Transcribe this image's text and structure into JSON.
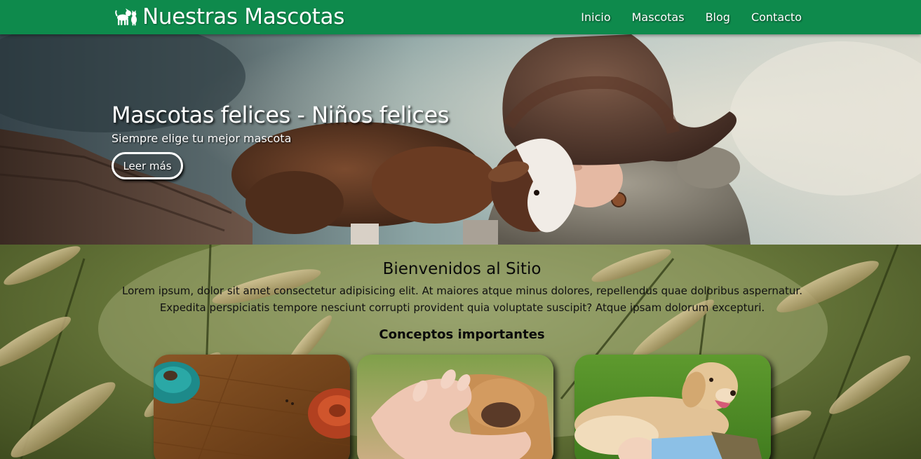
{
  "header": {
    "brand": "Nuestras Mascotas",
    "brand_icon": "pets-logo-icon",
    "background_color": "#0e8a4c",
    "nav": [
      {
        "label": "Inicio"
      },
      {
        "label": "Mascotas"
      },
      {
        "label": "Blog"
      },
      {
        "label": "Contacto"
      }
    ]
  },
  "hero": {
    "title": "Mascotas felices - Niños felices",
    "subtitle": "Siempre elige tu mejor mascota",
    "button_label": "Leer más"
  },
  "welcome": {
    "title": "Bienvenidos al Sitio",
    "text": "Lorem ipsum, dolor sit amet consectetur adipisicing elit. At maiores atque minus dolores, repellendus quae doloribus aspernatur. Expedita perspiciatis tempore nesciunt corrupti provident quia voluptate suscipit? Atque ipsam dolorum excepturi.",
    "concepts_title": "Conceptos importantes"
  },
  "cards": [
    {
      "image": "pet-food-bowls-image"
    },
    {
      "image": "hand-holding-paw-image"
    },
    {
      "image": "dog-and-child-image"
    }
  ]
}
